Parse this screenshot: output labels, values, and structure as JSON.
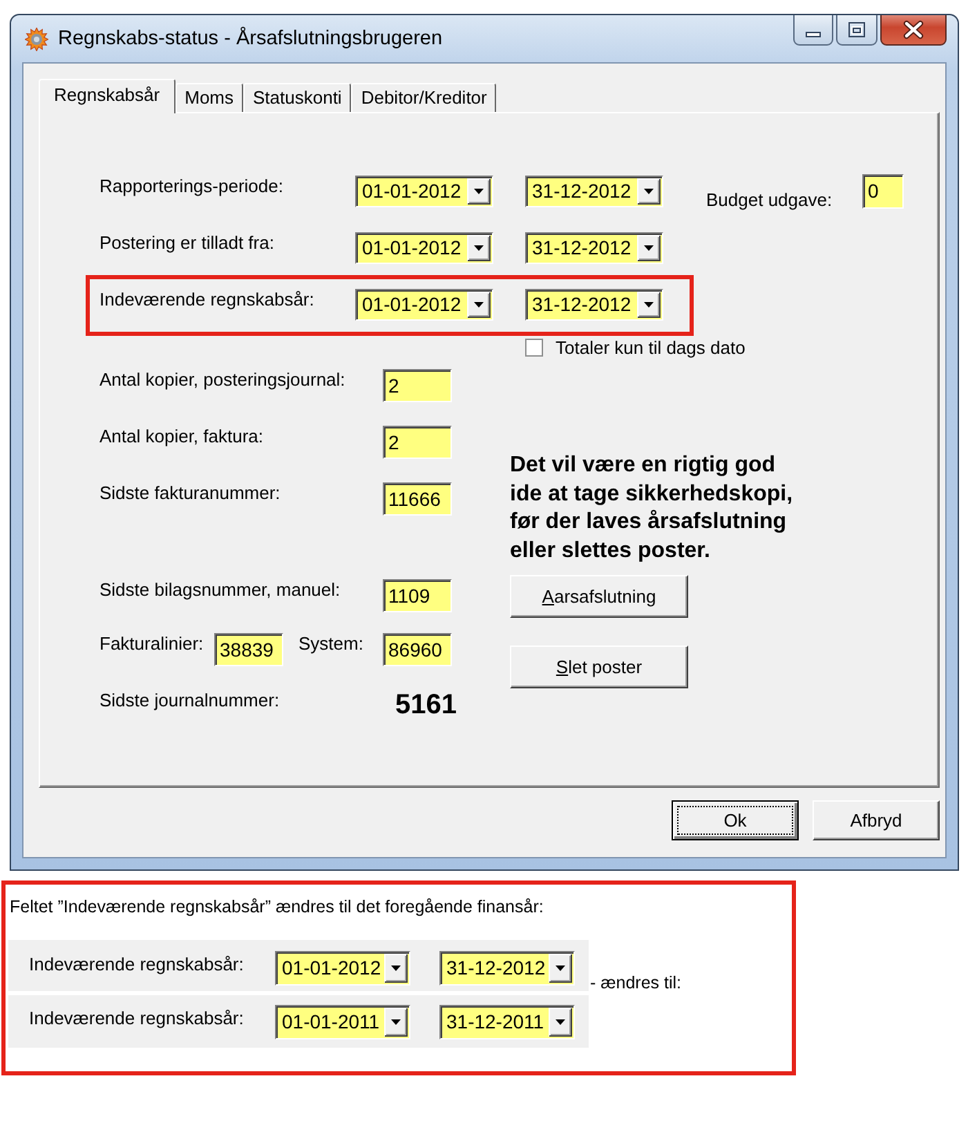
{
  "window": {
    "title": "Regnskabs-status - Årsafslutningsbrugeren"
  },
  "tabs": [
    {
      "label": "Regnskabsår",
      "selected": true
    },
    {
      "label": "Moms",
      "selected": false
    },
    {
      "label": "Statuskonti",
      "selected": false
    },
    {
      "label": "Debitor/Kreditor",
      "selected": false
    }
  ],
  "periods": [
    {
      "label": "Rapporterings-periode:",
      "from": "01-01-2012",
      "to": "31-12-2012",
      "highlighted": false
    },
    {
      "label": "Postering er tilladt fra:",
      "from": "01-01-2012",
      "to": "31-12-2012",
      "highlighted": false
    },
    {
      "label": "Indeværende regnskabsår:",
      "from": "01-01-2012",
      "to": "31-12-2012",
      "highlighted": true
    }
  ],
  "budget": {
    "label": "Budget udgave:",
    "value": "0"
  },
  "totals_checkbox": {
    "label": "Totaler kun til dags dato",
    "checked": false
  },
  "fields": [
    {
      "label": "Antal kopier, posteringsjournal:",
      "value": "2"
    },
    {
      "label": "Antal kopier, faktura:",
      "value": "2"
    },
    {
      "label": "Sidste fakturanummer:",
      "value": "11666"
    },
    {
      "label": "Sidste bilagsnummer, manuel:",
      "value": "1109"
    }
  ],
  "invoice_lines": {
    "label": "Fakturalinier:",
    "value": "38839",
    "system_label": "System:",
    "system_value": "86960"
  },
  "journal": {
    "label": "Sidste journalnummer:",
    "value": "5161"
  },
  "notice": {
    "lines": [
      "Det vil være en rigtig god",
      "ide at tage sikkerhedskopi,",
      "før der laves årsafslutning",
      "eller slettes poster."
    ]
  },
  "actions": [
    {
      "label": "Aarsafslutning",
      "mnemonic": true
    },
    {
      "label": "Slet poster",
      "mnemonic": true
    }
  ],
  "buttons": [
    {
      "label": "Ok",
      "focused": true
    },
    {
      "label": "Afbryd",
      "focused": false
    }
  ],
  "annotation": {
    "caption": "Feltet ”Indeværende regnskabsår” ændres til det foregående finansår:",
    "rows": [
      {
        "label": "Indeværende regnskabsår:",
        "from": "01-01-2012",
        "to": "31-12-2012"
      },
      {
        "label": "Indeværende regnskabsår:",
        "from": "01-01-2011",
        "to": "31-12-2011"
      }
    ],
    "change_label": "- ændres til:"
  }
}
